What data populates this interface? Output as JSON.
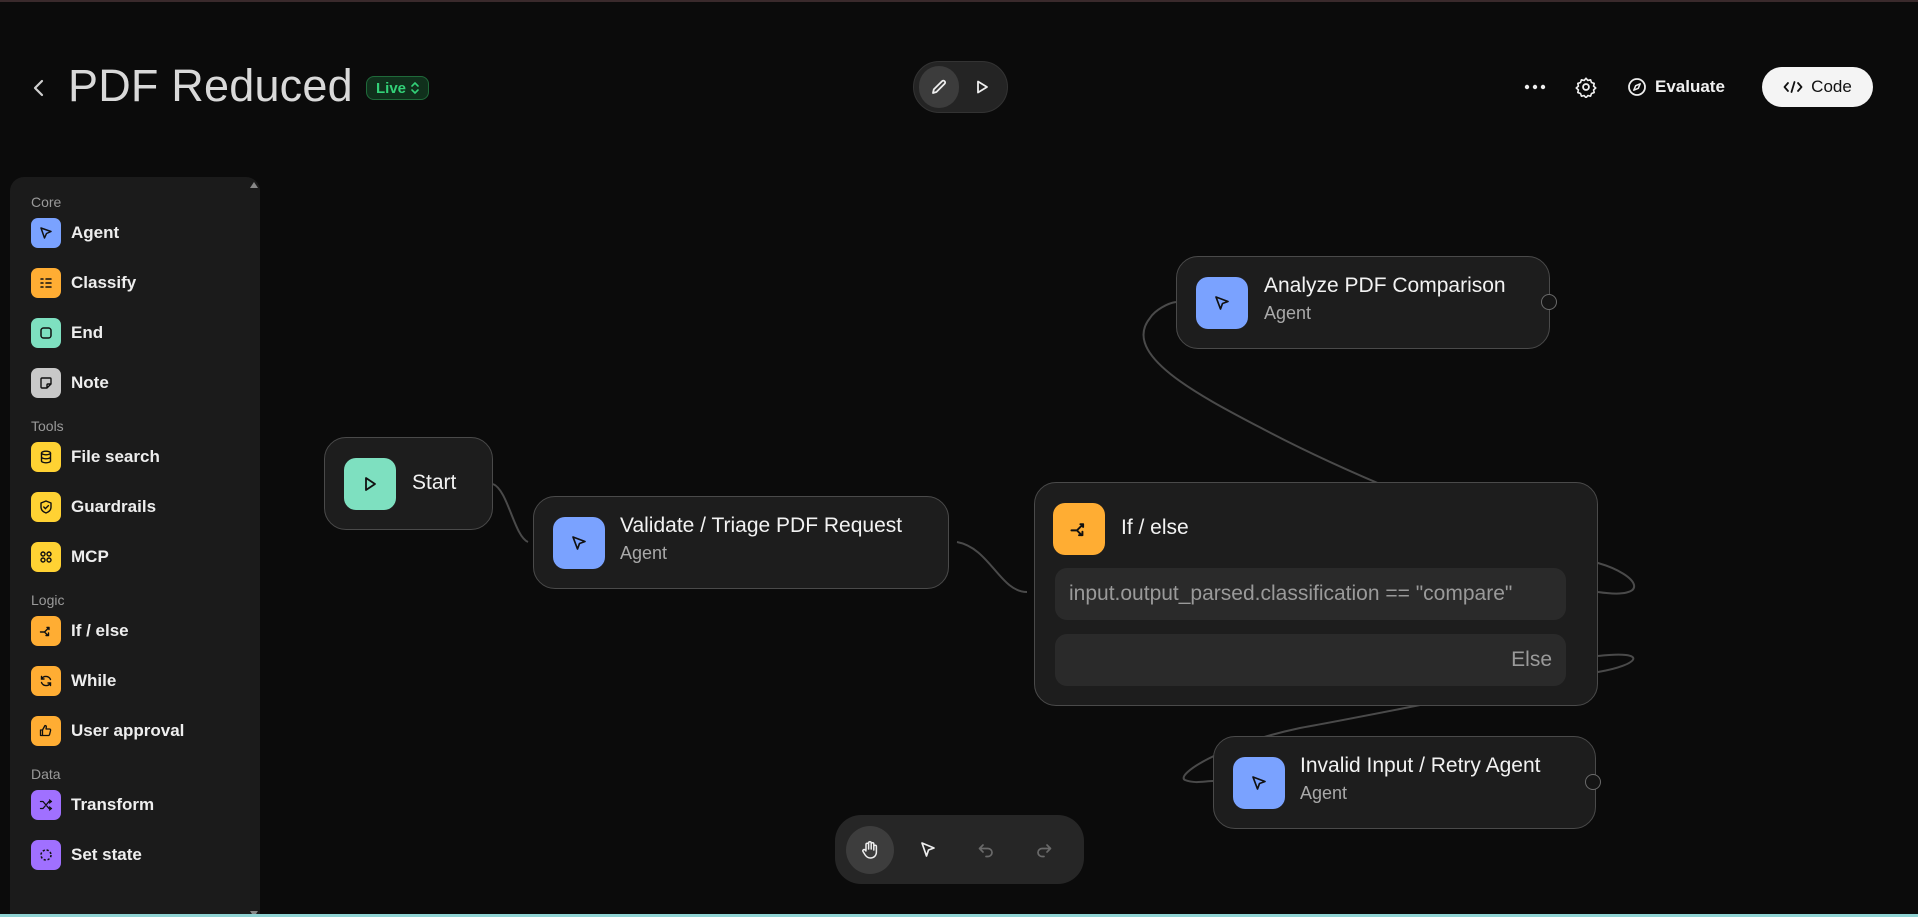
{
  "header": {
    "title": "PDF Reduced",
    "status_badge": "Live",
    "evaluate_label": "Evaluate",
    "code_label": "Code"
  },
  "sidebar": {
    "sections": [
      {
        "label": "Core",
        "items": [
          {
            "label": "Agent",
            "icon": "agent-icon",
            "color": "#7aa2ff"
          },
          {
            "label": "Classify",
            "icon": "classify-icon",
            "color": "#ffad33"
          },
          {
            "label": "End",
            "icon": "end-icon",
            "color": "#7ee0c0"
          },
          {
            "label": "Note",
            "icon": "note-icon",
            "color": "#c8c8c8"
          }
        ]
      },
      {
        "label": "Tools",
        "items": [
          {
            "label": "File search",
            "icon": "database-icon",
            "color": "#ffd233"
          },
          {
            "label": "Guardrails",
            "icon": "shield-icon",
            "color": "#ffd233"
          },
          {
            "label": "MCP",
            "icon": "mcp-icon",
            "color": "#ffd233"
          }
        ]
      },
      {
        "label": "Logic",
        "items": [
          {
            "label": "If / else",
            "icon": "branch-icon",
            "color": "#ffad33"
          },
          {
            "label": "While",
            "icon": "loop-icon",
            "color": "#ffad33"
          },
          {
            "label": "User approval",
            "icon": "thumbs-icon",
            "color": "#ffad33"
          }
        ]
      },
      {
        "label": "Data",
        "items": [
          {
            "label": "Transform",
            "icon": "shuffle-icon",
            "color": "#a070ff"
          },
          {
            "label": "Set state",
            "icon": "state-icon",
            "color": "#a070ff"
          }
        ]
      }
    ]
  },
  "nodes": {
    "start": {
      "title": "Start"
    },
    "validate": {
      "title": "Validate / Triage PDF Request",
      "subtitle": "Agent"
    },
    "ifelse": {
      "title": "If / else",
      "condition": "input.output_parsed.classification == \"compare\"",
      "else_label": "Else"
    },
    "analyze": {
      "title": "Analyze PDF Comparison",
      "subtitle": "Agent"
    },
    "invalid": {
      "title": "Invalid Input / Retry Agent",
      "subtitle": "Agent"
    }
  },
  "colors": {
    "agent": "#7aa2ff",
    "start": "#7ee0c0",
    "logic": "#ffad33",
    "live": "#33d178"
  }
}
